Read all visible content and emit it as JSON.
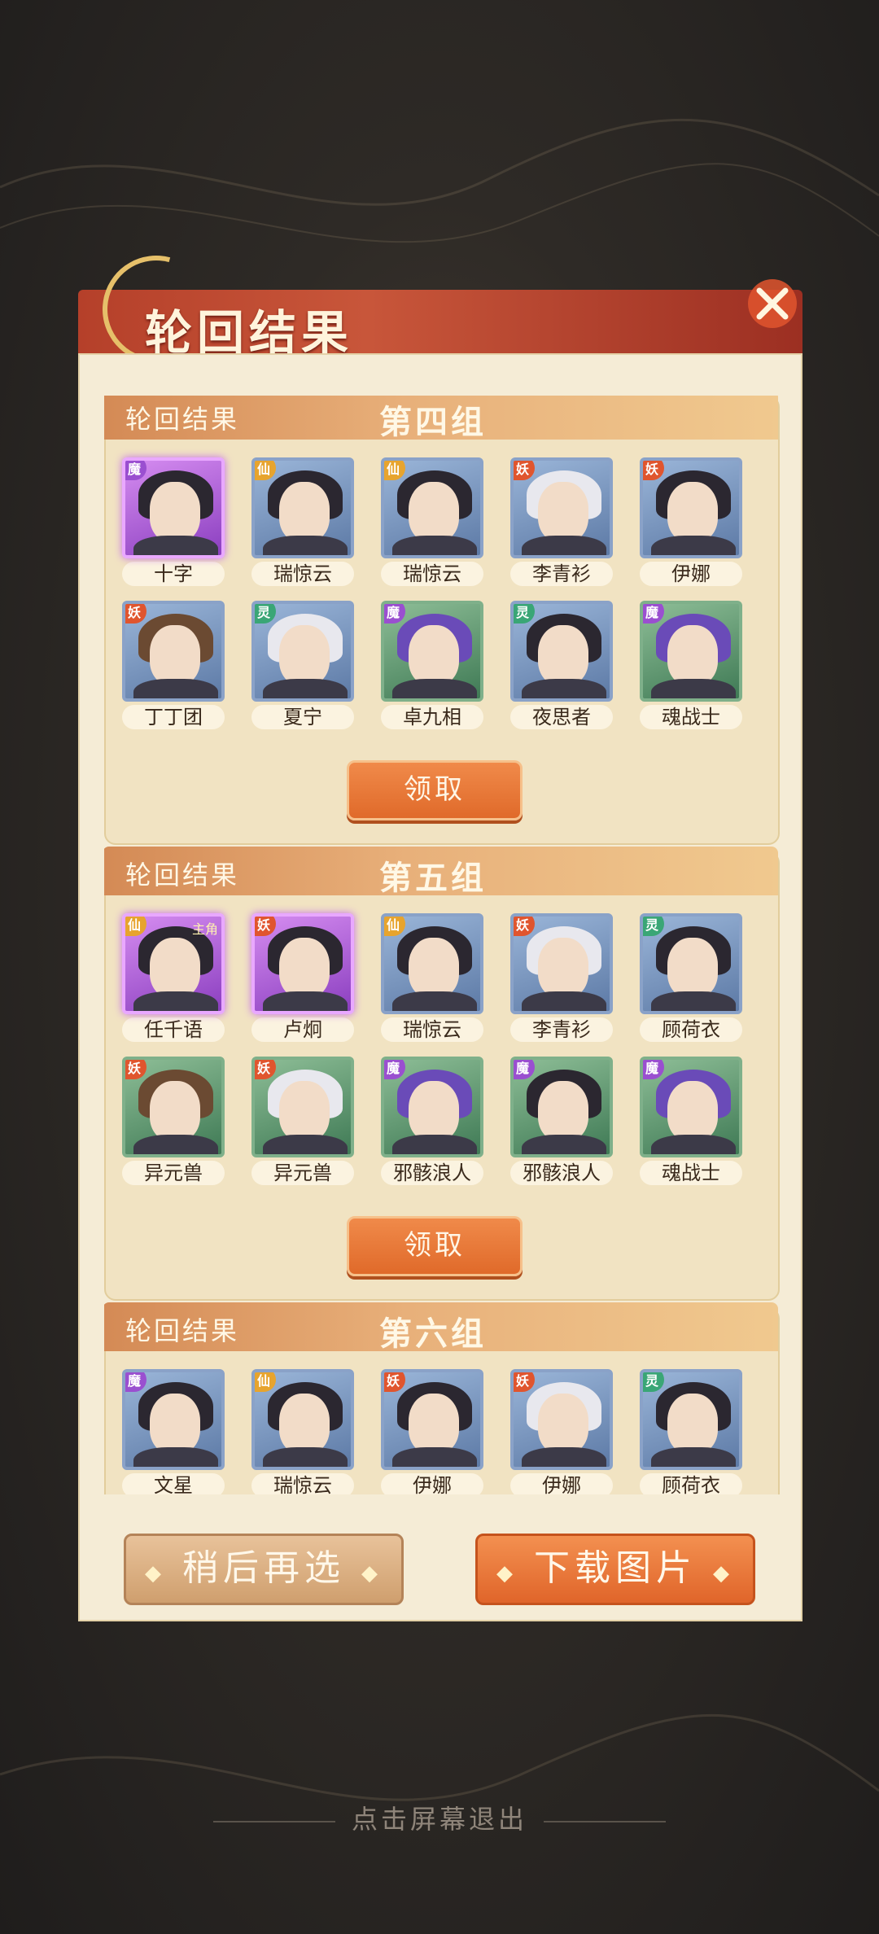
{
  "dialog": {
    "title": "轮回结果",
    "groups": [
      {
        "tag": "轮回结果",
        "name": "第四组",
        "claim_label": "领取",
        "characters": [
          {
            "name": "十字",
            "type": "魔"
          },
          {
            "name": "瑞惊云",
            "type": "仙"
          },
          {
            "name": "瑞惊云",
            "type": "仙"
          },
          {
            "name": "李青衫",
            "type": "妖"
          },
          {
            "name": "伊娜",
            "type": "妖"
          },
          {
            "name": "丁丁团",
            "type": "妖"
          },
          {
            "name": "夏宁",
            "type": "灵"
          },
          {
            "name": "卓九相",
            "type": "魔"
          },
          {
            "name": "夜思者",
            "type": "灵"
          },
          {
            "name": "魂战士",
            "type": "魔"
          }
        ]
      },
      {
        "tag": "轮回结果",
        "name": "第五组",
        "claim_label": "领取",
        "characters": [
          {
            "name": "任千语",
            "type": "仙",
            "extra": "主角"
          },
          {
            "name": "卢炯",
            "type": "妖"
          },
          {
            "name": "瑞惊云",
            "type": "仙"
          },
          {
            "name": "李青衫",
            "type": "妖"
          },
          {
            "name": "顾荷衣",
            "type": "灵"
          },
          {
            "name": "异元兽",
            "type": "妖"
          },
          {
            "name": "异元兽",
            "type": "妖"
          },
          {
            "name": "邪骸浪人",
            "type": "魔"
          },
          {
            "name": "邪骸浪人",
            "type": "魔"
          },
          {
            "name": "魂战士",
            "type": "魔"
          }
        ]
      },
      {
        "tag": "轮回结果",
        "name": "第六组",
        "characters": [
          {
            "name": "文星",
            "type": "魔"
          },
          {
            "name": "瑞惊云",
            "type": "仙"
          },
          {
            "name": "伊娜",
            "type": "妖"
          },
          {
            "name": "伊娜",
            "type": "妖"
          },
          {
            "name": "顾荷衣",
            "type": "灵"
          }
        ]
      }
    ],
    "later_label": "稍后再选",
    "download_label": "下载图片"
  },
  "exit_hint": "点击屏幕退出"
}
